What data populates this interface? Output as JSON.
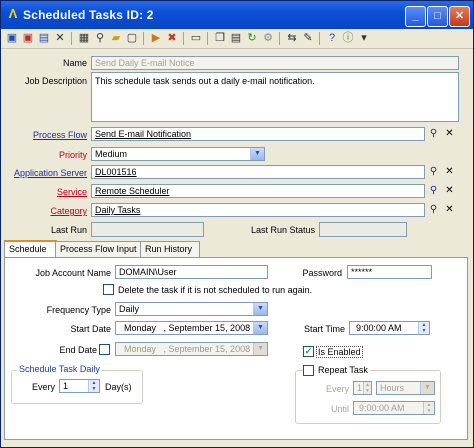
{
  "window": {
    "title": "Scheduled Tasks ID: 2",
    "app_glyph": "Λ",
    "minimize_glyph": "_",
    "maximize_glyph": "□",
    "close_glyph": "✕"
  },
  "toolbar": {
    "icons": [
      "save-icon",
      "save-close-icon",
      "new-icon",
      "delete-icon",
      "print-icon",
      "find-icon",
      "open-folder-icon",
      "properties-icon",
      "run-icon",
      "stop-icon",
      "log-icon",
      "copy-icon",
      "paste-icon",
      "refresh-icon",
      "settings-icon",
      "link-icon",
      "notes-icon",
      "help-icon",
      "info-icon",
      "more-icon"
    ]
  },
  "form": {
    "name_label": "Name",
    "name_value": "Send Daily E-mail Notice",
    "job_description_label": "Job Description",
    "job_description_value": "This schedule task sends out a daily e-mail notification.",
    "process_flow_label": "Process Flow",
    "process_flow_value": "Send E-mail Notification",
    "priority_label": "Priority",
    "priority_value": "Medium",
    "application_server_label": "Application Server",
    "application_server_value": "DL001516",
    "service_label": "Service",
    "service_value": "Remote Scheduler",
    "category_label": "Category",
    "category_value": "Daily Tasks",
    "last_run_label": "Last Run",
    "last_run_value": "",
    "last_run_status_label": "Last Run Status",
    "last_run_status_value": ""
  },
  "tabs": [
    {
      "label": "Schedule",
      "active": true
    },
    {
      "label": "Process Flow Input",
      "active": false
    },
    {
      "label": "Run History",
      "active": false
    }
  ],
  "schedule": {
    "job_account_name_label": "Job Account Name",
    "job_account_name_value": "DOMAIN\\User",
    "password_label": "Password",
    "password_value": "******",
    "delete_task_label": "Delete the task if it is not scheduled to run again.",
    "delete_task_checked": false,
    "frequency_type_label": "Frequency Type",
    "frequency_type_value": "Daily",
    "start_date_label": "Start Date",
    "start_date_value": "Monday   , September 15, 2008",
    "start_time_label": "Start Time",
    "start_time_value": "9:00:00 AM",
    "end_date_label": "End Date",
    "end_date_checked": false,
    "end_date_value": "Monday   , September 15, 2008",
    "is_enabled_label": "Is Enabled",
    "is_enabled_checked": true,
    "daily_group_title": "Schedule Task Daily",
    "every_label": "Every",
    "every_value": "1",
    "days_label": "Day(s)",
    "repeat_task_label": "Repeat Task",
    "repeat_task_checked": false,
    "repeat_every_label": "Every",
    "repeat_every_value": "1",
    "repeat_unit_value": "Hours",
    "until_label": "Until",
    "until_value": "9:00:00 AM"
  },
  "glyphs": {
    "binoculars": "⚲",
    "clear": "✕",
    "dropdown": "▼",
    "spin_up": "▲",
    "spin_down": "▼",
    "check": "✓"
  },
  "colors": {
    "title_bar": "#0b4fd6",
    "link_label": "#1a2fa0",
    "required_label": "#c4001a",
    "active_tab_accent": "#e68b2c"
  }
}
